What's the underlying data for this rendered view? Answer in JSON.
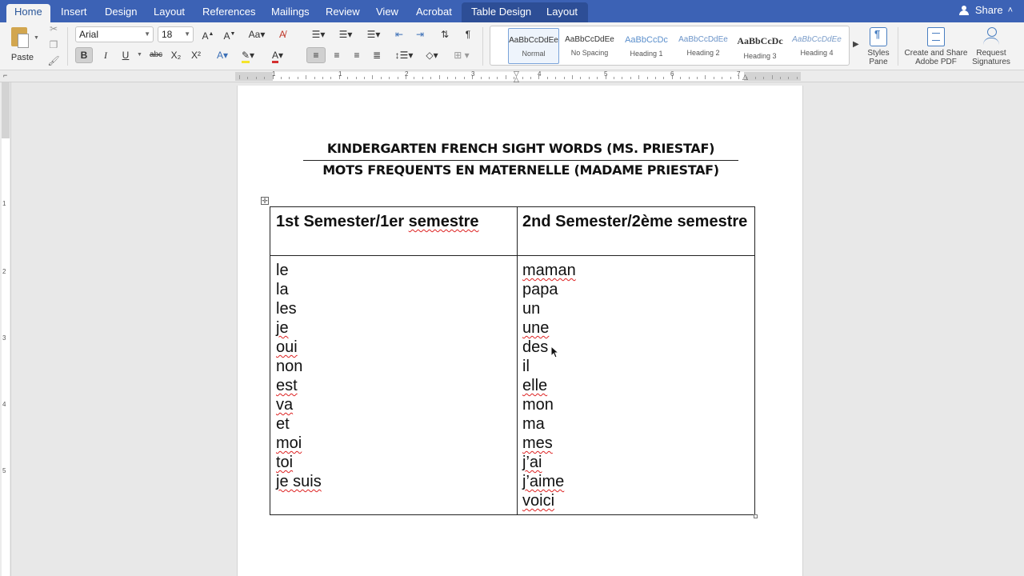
{
  "tabs": [
    {
      "label": "Home",
      "active": true
    },
    {
      "label": "Insert"
    },
    {
      "label": "Design"
    },
    {
      "label": "Layout"
    },
    {
      "label": "References"
    },
    {
      "label": "Mailings"
    },
    {
      "label": "Review"
    },
    {
      "label": "View"
    },
    {
      "label": "Acrobat"
    },
    {
      "label": "Table Design",
      "contextual": true
    },
    {
      "label": "Layout",
      "contextual": true
    }
  ],
  "share_label": "Share",
  "ribbon": {
    "paste_label": "Paste",
    "font_name": "Arial",
    "font_size": "18",
    "bold_label": "B",
    "italic_label": "I",
    "underline_label": "U",
    "strike_label": "abc",
    "subscript_label": "X₂",
    "superscript_label": "X²",
    "styles": [
      {
        "sample": "AaBbCcDdEe",
        "name": "Normal",
        "selected": true
      },
      {
        "sample": "AaBbCcDdEe",
        "name": "No Spacing"
      },
      {
        "sample": "AaBbCcDc",
        "name": "Heading 1"
      },
      {
        "sample": "AaBbCcDdEe",
        "name": "Heading 2"
      },
      {
        "sample": "AaBbCcDc",
        "name": "Heading 3"
      },
      {
        "sample": "AaBbCcDdEe",
        "name": "Heading 4"
      }
    ],
    "styles_pane_label": "Styles\nPane",
    "create_share_label": "Create and Share\nAdobe PDF",
    "request_sig_label": "Request\nSignatures"
  },
  "ruler": {
    "numbers": [
      "1",
      "1",
      "2",
      "3",
      "4",
      "5",
      "6",
      "7"
    ],
    "vnumbers": [
      "1",
      "2",
      "3",
      "4",
      "5"
    ]
  },
  "document": {
    "title_line1": "KINDERGARTEN FRENCH SIGHT WORDS (MS. PRIESTAF)",
    "title_line2": "MOTS FREQUENTS EN MATERNELLE (MADAME PRIESTAF)",
    "table": {
      "headers": [
        "1st Semester/1er semestre",
        "2nd Semester/2ème semestre"
      ],
      "col1": [
        "le",
        "la",
        "les",
        "je",
        "oui",
        "non",
        "est",
        "va",
        "et",
        "moi",
        "toi",
        "je suis"
      ],
      "col2": [
        "maman",
        "papa",
        "un",
        "une",
        "des",
        "il",
        "elle",
        "mon",
        "ma",
        "mes",
        "j’ai",
        "j’aime",
        "voici"
      ]
    }
  }
}
